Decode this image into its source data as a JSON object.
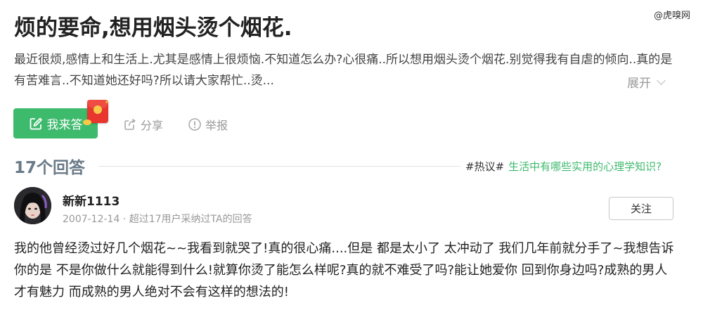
{
  "watermark": "@虎嗅网",
  "question": {
    "title": "烦的要命,想用烟头烫个烟花.",
    "description": "最近很烦,感情上和生活上.尤其是感情上很烦恼.不知道怎么办?心很痛..所以想用烟头烫个烟花.别觉得我有自虐的倾向..真的是有苦难言..不知道她还好吗?所以请大家帮忙..烫...",
    "expand_label": "展开"
  },
  "actions": {
    "answer_label": "我来答",
    "share_label": "分享",
    "report_label": "举报"
  },
  "answers_header": {
    "count_label": "17个回答",
    "hot_tag": "#热议#",
    "hot_topic": "生活中有哪些实用的心理学知识?"
  },
  "answer": {
    "username": "新新1113",
    "meta": "2007-12-14 · 超过17用户采纳过TA的回答",
    "follow_label": "关注",
    "body": "我的他曾经烫过好几个烟花~~我看到就哭了!真的很心痛....但是 都是太小了 太冲动了 我们几年前就分手了~我想告诉你的是 不是你做什么就能得到什么!就算你烫了能怎么样呢?真的就不难受了吗?能让她爱你 回到你身边吗?成熟的男人 才有魅力 而成熟的男人绝对不会有这样的想法的!"
  },
  "colors": {
    "accent_green": "#3eba6d",
    "muted_gray": "#999999",
    "count_slate": "#6a7a88"
  },
  "icons": [
    "edit-icon",
    "red-packet-icon",
    "share-icon",
    "report-icon",
    "chevron-down-icon"
  ]
}
